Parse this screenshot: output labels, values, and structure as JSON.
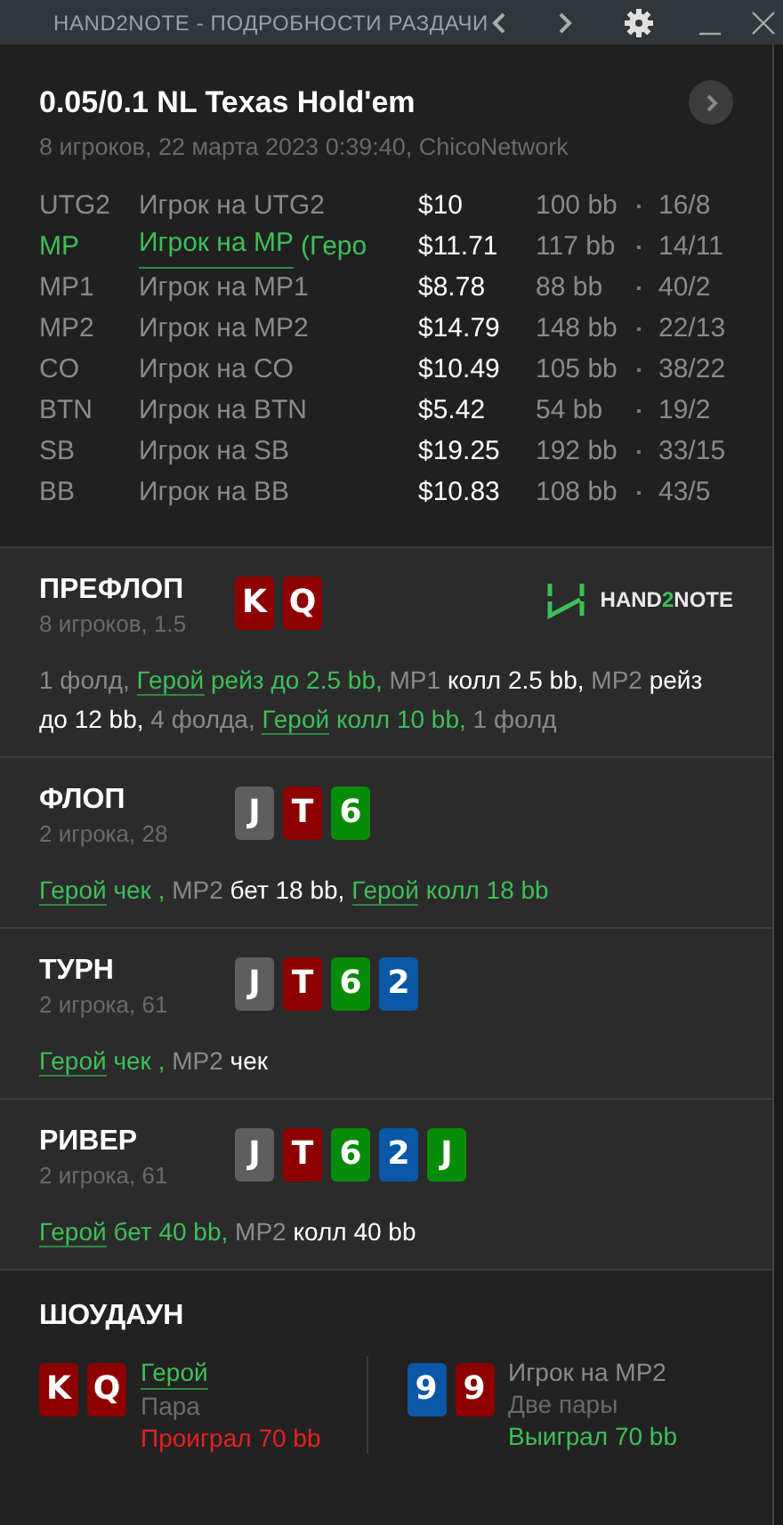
{
  "window": {
    "title": "HAND2NOTE - ПОДРОБНОСТИ РАЗДАЧИ"
  },
  "hand": {
    "title": "0.05/0.1 NL Texas Hold'em",
    "subtitle": "8 игроков, 22 марта 2023 0:39:40, ChicoNetwork"
  },
  "players": [
    {
      "position": "UTG2",
      "name": "Игрок на UTG2",
      "hero": false,
      "stack": "$10",
      "bb": "100 bb",
      "stats": "16/8"
    },
    {
      "position": "MP",
      "name": "Игрок на MP",
      "suffix": "(Геро",
      "hero": true,
      "stack": "$11.71",
      "bb": "117 bb",
      "stats": "14/11"
    },
    {
      "position": "MP1",
      "name": "Игрок на MP1",
      "hero": false,
      "stack": "$8.78",
      "bb": "88 bb",
      "stats": "40/2"
    },
    {
      "position": "MP2",
      "name": "Игрок на MP2",
      "hero": false,
      "stack": "$14.79",
      "bb": "148 bb",
      "stats": "22/13"
    },
    {
      "position": "CO",
      "name": "Игрок на CO",
      "hero": false,
      "stack": "$10.49",
      "bb": "105 bb",
      "stats": "38/22"
    },
    {
      "position": "BTN",
      "name": "Игрок на BTN",
      "hero": false,
      "stack": "$5.42",
      "bb": "54 bb",
      "stats": "19/2"
    },
    {
      "position": "SB",
      "name": "Игрок на SB",
      "hero": false,
      "stack": "$19.25",
      "bb": "192 bb",
      "stats": "33/15"
    },
    {
      "position": "BB",
      "name": "Игрок на BB",
      "hero": false,
      "stack": "$10.83",
      "bb": "108 bb",
      "stats": "43/5"
    }
  ],
  "logo": {
    "parts": [
      {
        "text": "HAND",
        "accent": false
      },
      {
        "text": "2",
        "accent": true
      },
      {
        "text": "NOTE",
        "accent": false
      }
    ]
  },
  "streets": [
    {
      "name": "ПРЕФЛОП",
      "info": "8 игроков, 1.5",
      "logo": true,
      "cards": [
        {
          "rank": "K",
          "color": "#8e0000"
        },
        {
          "rank": "Q",
          "color": "#8e0000"
        }
      ],
      "actions": [
        {
          "kind": "player",
          "text": "1 фолд,"
        },
        {
          "kind": "hero",
          "text": "Герой"
        },
        {
          "kind": "hero_action",
          "text": "рейз до 2.5 bb,"
        },
        {
          "kind": "player",
          "text": "MP1"
        },
        {
          "kind": "action",
          "text": "колл 2.5 bb,"
        },
        {
          "kind": "player",
          "text": "MP2"
        },
        {
          "kind": "action",
          "text": "рейз до 12 bb,"
        },
        {
          "kind": "player",
          "text": "4 фолда,"
        },
        {
          "kind": "hero",
          "text": "Герой"
        },
        {
          "kind": "hero_action",
          "text": "колл 10 bb,"
        },
        {
          "kind": "player",
          "text": "1 фолд"
        }
      ]
    },
    {
      "name": "ФЛОП",
      "info": "2 игрока, 28",
      "logo": false,
      "cards": [
        {
          "rank": "J",
          "color": "#5e5e5e"
        },
        {
          "rank": "T",
          "color": "#8e0000"
        },
        {
          "rank": "6",
          "color": "#078c07"
        }
      ],
      "actions": [
        {
          "kind": "hero",
          "text": "Герой"
        },
        {
          "kind": "hero_action",
          "text": "чек ,"
        },
        {
          "kind": "player",
          "text": "MP2"
        },
        {
          "kind": "action",
          "text": "бет 18 bb,"
        },
        {
          "kind": "hero",
          "text": "Герой"
        },
        {
          "kind": "hero_action",
          "text": "колл 18 bb"
        }
      ]
    },
    {
      "name": "ТУРН",
      "info": "2 игрока, 61",
      "logo": false,
      "cards": [
        {
          "rank": "J",
          "color": "#5e5e5e"
        },
        {
          "rank": "T",
          "color": "#8e0000"
        },
        {
          "rank": "6",
          "color": "#078c07"
        },
        {
          "rank": "2",
          "color": "#0a57a8"
        }
      ],
      "actions": [
        {
          "kind": "hero",
          "text": "Герой"
        },
        {
          "kind": "hero_action",
          "text": "чек ,"
        },
        {
          "kind": "player",
          "text": "MP2"
        },
        {
          "kind": "action",
          "text": "чек"
        }
      ]
    },
    {
      "name": "РИВЕР",
      "info": "2 игрока, 61",
      "logo": false,
      "cards": [
        {
          "rank": "J",
          "color": "#5e5e5e"
        },
        {
          "rank": "T",
          "color": "#8e0000"
        },
        {
          "rank": "6",
          "color": "#078c07"
        },
        {
          "rank": "2",
          "color": "#0a57a8"
        },
        {
          "rank": "J",
          "color": "#078c07"
        }
      ],
      "actions": [
        {
          "kind": "hero",
          "text": "Герой"
        },
        {
          "kind": "hero_action",
          "text": "бет 40 bb,"
        },
        {
          "kind": "player",
          "text": "MP2"
        },
        {
          "kind": "action",
          "text": "колл 40 bb"
        }
      ]
    }
  ],
  "showdown": {
    "title": "ШОУДАУН",
    "hands": [
      {
        "cards": [
          {
            "rank": "K",
            "color": "#8e0000"
          },
          {
            "rank": "Q",
            "color": "#8e0000"
          }
        ],
        "name": "Герой",
        "hero": true,
        "hand": "Пара",
        "result": "Проиграл 70 bb",
        "won": false
      },
      {
        "cards": [
          {
            "rank": "9",
            "color": "#0a57a8"
          },
          {
            "rank": "9",
            "color": "#8e0000"
          }
        ],
        "name": "Игрок на MP2",
        "hero": false,
        "hand": "Две пары",
        "result": "Выиграл 70 bb",
        "won": true
      }
    ]
  }
}
